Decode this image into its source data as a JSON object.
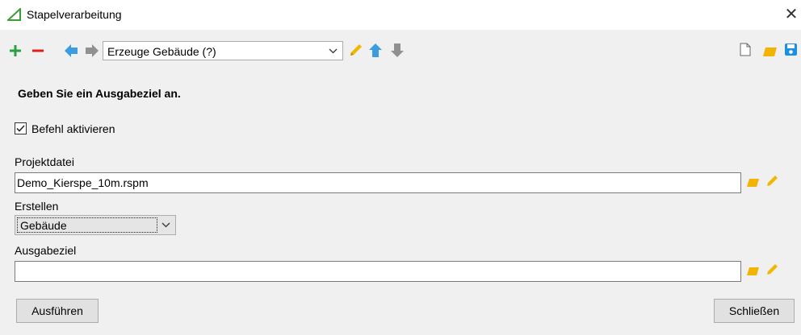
{
  "window": {
    "title": "Stapelverarbeitung",
    "close_glyph": "✕"
  },
  "toolbar": {
    "command_select": {
      "value": "Erzeuge Gebäude (?)"
    },
    "icons": [
      "add-icon",
      "remove-icon",
      "arrow-left-icon",
      "arrow-right-icon",
      "pencil-icon",
      "arrow-up-icon",
      "arrow-down-icon",
      "new-file-icon",
      "folder-open-icon",
      "save-icon"
    ]
  },
  "form": {
    "instruction": "Geben Sie ein Ausgabeziel an.",
    "activate_checkbox": {
      "label": "Befehl aktivieren",
      "checked": true
    },
    "project_file": {
      "label": "Projektdatei",
      "value": "Demo_Kierspe_10m.rspm"
    },
    "create": {
      "label": "Erstellen",
      "value": "Gebäude"
    },
    "output_target": {
      "label": "Ausgabeziel",
      "value": ""
    }
  },
  "buttons": {
    "run": "Ausführen",
    "close": "Schließen"
  },
  "colors": {
    "add": "#2aa043",
    "remove": "#e0201b",
    "arrows_active": "#3d9be0",
    "arrows_inactive": "#909090",
    "pencil": "#f0b800",
    "folder": "#f2b400",
    "save": "#1b8fe0",
    "logo": "#3f9b3b"
  }
}
